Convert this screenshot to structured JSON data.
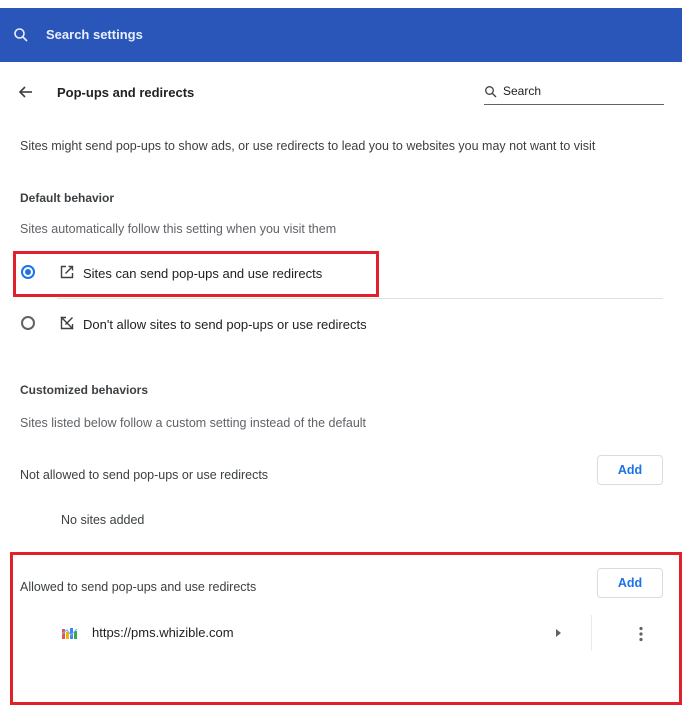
{
  "header": {
    "search_placeholder": "Search settings",
    "background": "#2a56b9"
  },
  "page": {
    "title": "Pop-ups and redirects",
    "search_label": "Search",
    "description": "Sites might send pop-ups to show ads, or use redirects to lead you to websites you may not want to visit"
  },
  "default_behavior": {
    "heading": "Default behavior",
    "subtext": "Sites automatically follow this setting when you visit them",
    "options": [
      {
        "label": "Sites can send pop-ups and use redirects",
        "selected": true,
        "icon": "open-in-new-icon"
      },
      {
        "label": "Don't allow sites to send pop-ups or use redirects",
        "selected": false,
        "icon": "popup-blocked-icon"
      }
    ]
  },
  "customized": {
    "heading": "Customized behaviors",
    "subtext": "Sites listed below follow a custom setting instead of the default",
    "not_allowed": {
      "label": "Not allowed to send pop-ups or use redirects",
      "add_label": "Add",
      "empty_text": "No sites added"
    },
    "allowed": {
      "label": "Allowed to send pop-ups and use redirects",
      "add_label": "Add",
      "sites": [
        {
          "url": "https://pms.whizible.com"
        }
      ]
    }
  },
  "colors": {
    "accent": "#1a73e8",
    "highlight_box": "#e0212b"
  }
}
